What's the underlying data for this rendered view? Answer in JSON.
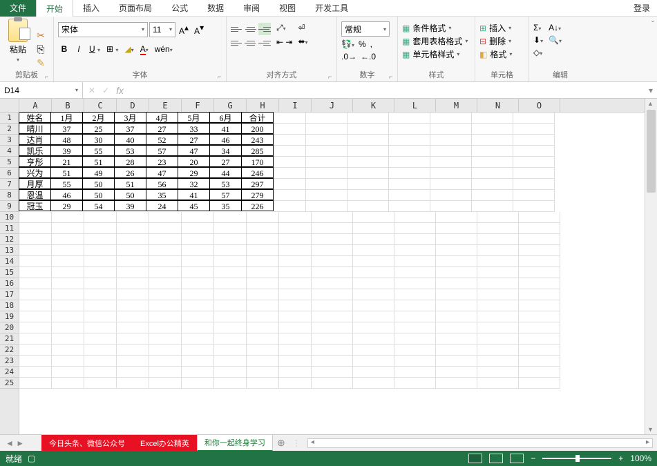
{
  "menu": {
    "file": "文件",
    "home": "开始",
    "insert": "插入",
    "layout": "页面布局",
    "formula": "公式",
    "data": "数据",
    "review": "审阅",
    "view": "视图",
    "dev": "开发工具",
    "login": "登录"
  },
  "ribbon": {
    "clipboard": {
      "paste": "粘贴",
      "label": "剪贴板"
    },
    "font": {
      "name": "宋体",
      "size": "11",
      "label": "字体"
    },
    "align": {
      "label": "对齐方式"
    },
    "number": {
      "format": "常规",
      "label": "数字"
    },
    "styles": {
      "cond": "条件格式",
      "table": "套用表格格式",
      "cell": "单元格样式",
      "label": "样式"
    },
    "cells": {
      "insert": "插入",
      "delete": "删除",
      "format": "格式",
      "label": "单元格"
    },
    "editing": {
      "label": "编辑"
    }
  },
  "namebox": "D14",
  "columns": [
    "A",
    "B",
    "C",
    "D",
    "E",
    "F",
    "G",
    "H",
    "I",
    "J",
    "K",
    "L",
    "M",
    "N",
    "O"
  ],
  "chart_data": {
    "type": "table",
    "headers": [
      "姓名",
      "1月",
      "2月",
      "3月",
      "4月",
      "5月",
      "6月",
      "合计"
    ],
    "rows": [
      [
        "晴川",
        37,
        25,
        37,
        27,
        33,
        41,
        200
      ],
      [
        "达肖",
        48,
        30,
        40,
        52,
        27,
        46,
        243
      ],
      [
        "凯乐",
        39,
        55,
        53,
        57,
        47,
        34,
        285
      ],
      [
        "亨彤",
        21,
        51,
        28,
        23,
        20,
        27,
        170
      ],
      [
        "兴为",
        51,
        49,
        26,
        47,
        29,
        44,
        246
      ],
      [
        "月厚",
        55,
        50,
        51,
        56,
        32,
        53,
        297
      ],
      [
        "恩温",
        46,
        50,
        50,
        35,
        41,
        57,
        279
      ],
      [
        "冠玉",
        29,
        54,
        39,
        24,
        45,
        35,
        226
      ]
    ]
  },
  "sheets": {
    "s1": "今日头条、微信公众号",
    "s2": "Excel办公精英",
    "s3": "和你一起终身学习"
  },
  "status": {
    "ready": "就绪",
    "calc": "",
    "zoom": "100%"
  }
}
